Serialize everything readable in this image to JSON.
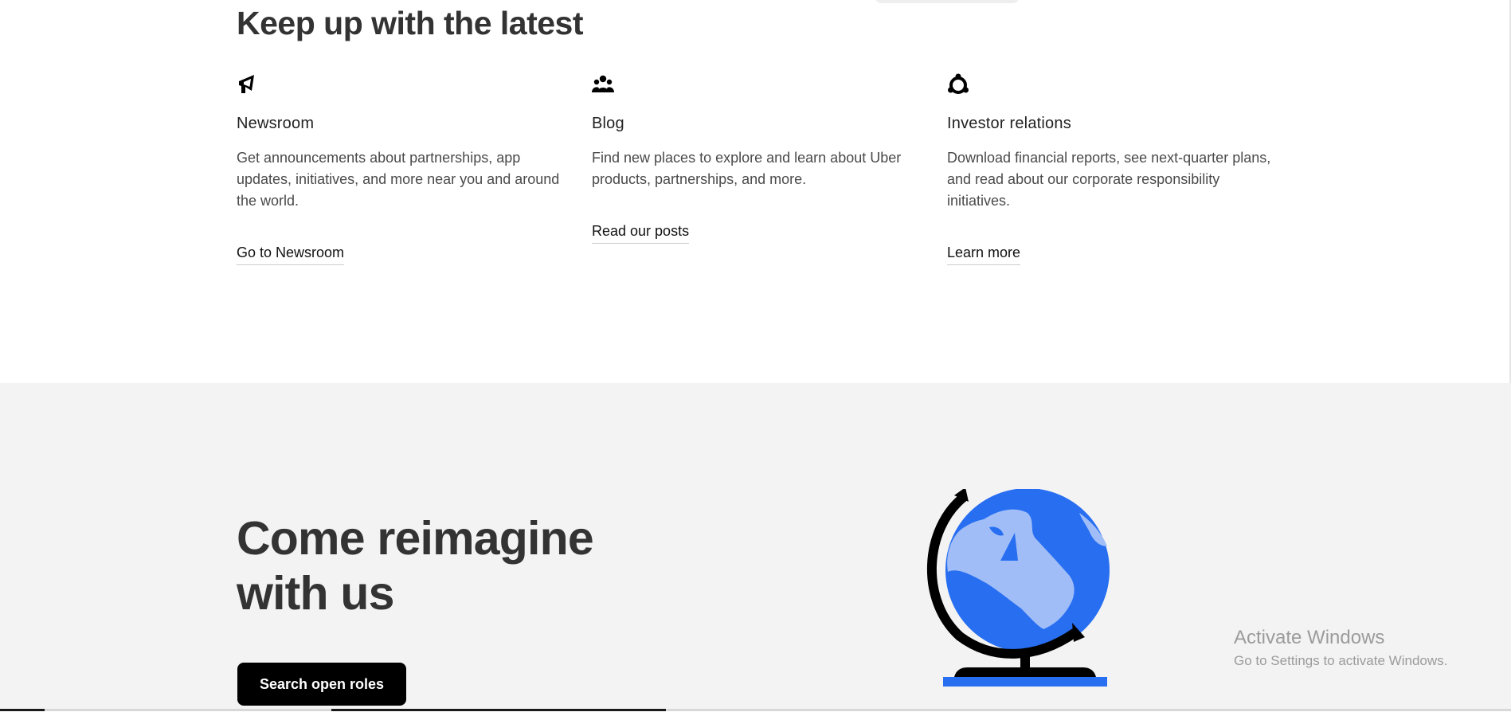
{
  "latest": {
    "title": "Keep up with the latest",
    "cards": [
      {
        "icon": "megaphone-icon",
        "title": "Newsroom",
        "description": "Get announcements about partnerships, app updates, initiatives, and more near you and around the world.",
        "link": "Go to Newsroom"
      },
      {
        "icon": "people-group-icon",
        "title": "Blog",
        "description": "Find new places to explore and learn about Uber products, partnerships, and more.",
        "link": "Read our posts"
      },
      {
        "icon": "investor-circle-icon",
        "title": "Investor relations",
        "description": "Download financial reports, see next-quarter plans, and read about our corporate responsibility initiatives.",
        "link": "Learn more"
      }
    ]
  },
  "careers": {
    "title_line1": "Come reimagine",
    "title_line2": "with us",
    "button": "Search open roles",
    "illustration": "globe-illustration"
  },
  "watermark": {
    "title": "Activate Windows",
    "subtitle": "Go to Settings to activate Windows."
  },
  "colors": {
    "section_background": "#f3f3f3",
    "text_primary": "#333333",
    "button_background": "#000000",
    "globe_blue": "#276ef1",
    "globe_light_blue": "#a0bdf7"
  }
}
